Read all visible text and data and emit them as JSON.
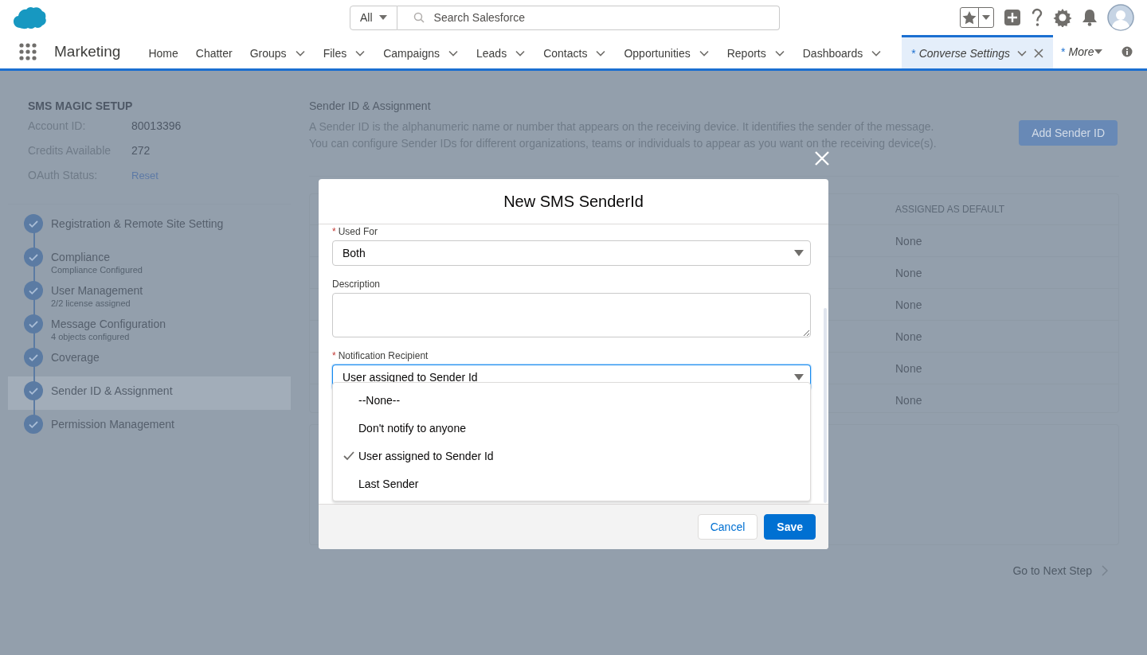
{
  "header": {
    "search_scope": "All",
    "search_placeholder": "Search Salesforce"
  },
  "nav": {
    "app_name": "Marketing",
    "tabs": [
      {
        "label": "Home",
        "has_menu": false,
        "closable": false,
        "selected": false
      },
      {
        "label": "Chatter",
        "has_menu": false,
        "closable": false,
        "selected": false
      },
      {
        "label": "Groups",
        "has_menu": true,
        "closable": false,
        "selected": false
      },
      {
        "label": "Files",
        "has_menu": true,
        "closable": false,
        "selected": false
      },
      {
        "label": "Campaigns",
        "has_menu": true,
        "closable": false,
        "selected": false
      },
      {
        "label": "Leads",
        "has_menu": true,
        "closable": false,
        "selected": false
      },
      {
        "label": "Contacts",
        "has_menu": true,
        "closable": false,
        "selected": false
      },
      {
        "label": "Opportunities",
        "has_menu": true,
        "closable": false,
        "selected": false
      },
      {
        "label": "Reports",
        "has_menu": true,
        "closable": false,
        "selected": false
      },
      {
        "label": "Dashboards",
        "has_menu": true,
        "closable": false,
        "selected": false
      },
      {
        "prefix": "*",
        "label": "Converse Settings",
        "has_menu": true,
        "closable": true,
        "selected": true
      }
    ],
    "more": {
      "prefix": "*",
      "label": "More"
    }
  },
  "sidebar": {
    "title": "SMS MAGIC SETUP",
    "info": [
      {
        "label": "Account ID:",
        "value": "80013396",
        "kind": "text"
      },
      {
        "label": "Credits Available",
        "value": "272",
        "kind": "text"
      },
      {
        "label": "OAuth Status:",
        "value": "Reset",
        "kind": "link"
      }
    ],
    "steps": [
      {
        "title": "Registration & Remote Site Setting",
        "completed": true,
        "selected": false
      },
      {
        "title": "Compliance",
        "subtitle": "Compliance Configured",
        "completed": true,
        "selected": false
      },
      {
        "title": "User Management",
        "subtitle": "2/2 license assigned",
        "completed": true,
        "selected": false
      },
      {
        "title": "Message Configuration",
        "subtitle": "4 objects configured",
        "completed": true,
        "selected": false
      },
      {
        "title": "Coverage",
        "completed": true,
        "selected": false
      },
      {
        "title": "Sender ID & Assignment",
        "completed": true,
        "selected": true
      },
      {
        "title": "Permission Management",
        "completed": true,
        "selected": false
      }
    ]
  },
  "main": {
    "title": "Sender ID & Assignment",
    "description": [
      "A Sender ID is the alphanumeric name or number that appears on the receiving device. It identifies the sender of the message.",
      "You can configure Sender IDs for different organizations, teams or individuals to appear as you want on the receiving device(s)."
    ],
    "add_button": "Add Sender ID",
    "table": {
      "columns": [
        "ASSIGNED AS DEFAULT"
      ],
      "rows": [
        "None",
        "None",
        "None",
        "None",
        "None",
        "None"
      ]
    },
    "next_step": "Go to Next Step"
  },
  "modal": {
    "title": "New SMS SenderId",
    "fields": [
      {
        "kind": "select",
        "label": "Used For",
        "required": true,
        "value": "Both",
        "focused": false
      },
      {
        "kind": "textarea",
        "label": "Description",
        "required": false
      },
      {
        "kind": "select",
        "label": "Notification Recipient",
        "required": true,
        "value": "User assigned to Sender Id",
        "focused": true,
        "options": [
          {
            "label": "--None--",
            "selected": false
          },
          {
            "label": "Don't notify to anyone",
            "selected": false
          },
          {
            "label": "User assigned to Sender Id",
            "selected": true
          },
          {
            "label": "Last Sender",
            "selected": false
          }
        ]
      }
    ],
    "buttons": [
      {
        "label": "Cancel",
        "kind": "neutral"
      },
      {
        "label": "Save",
        "kind": "brand"
      }
    ]
  }
}
